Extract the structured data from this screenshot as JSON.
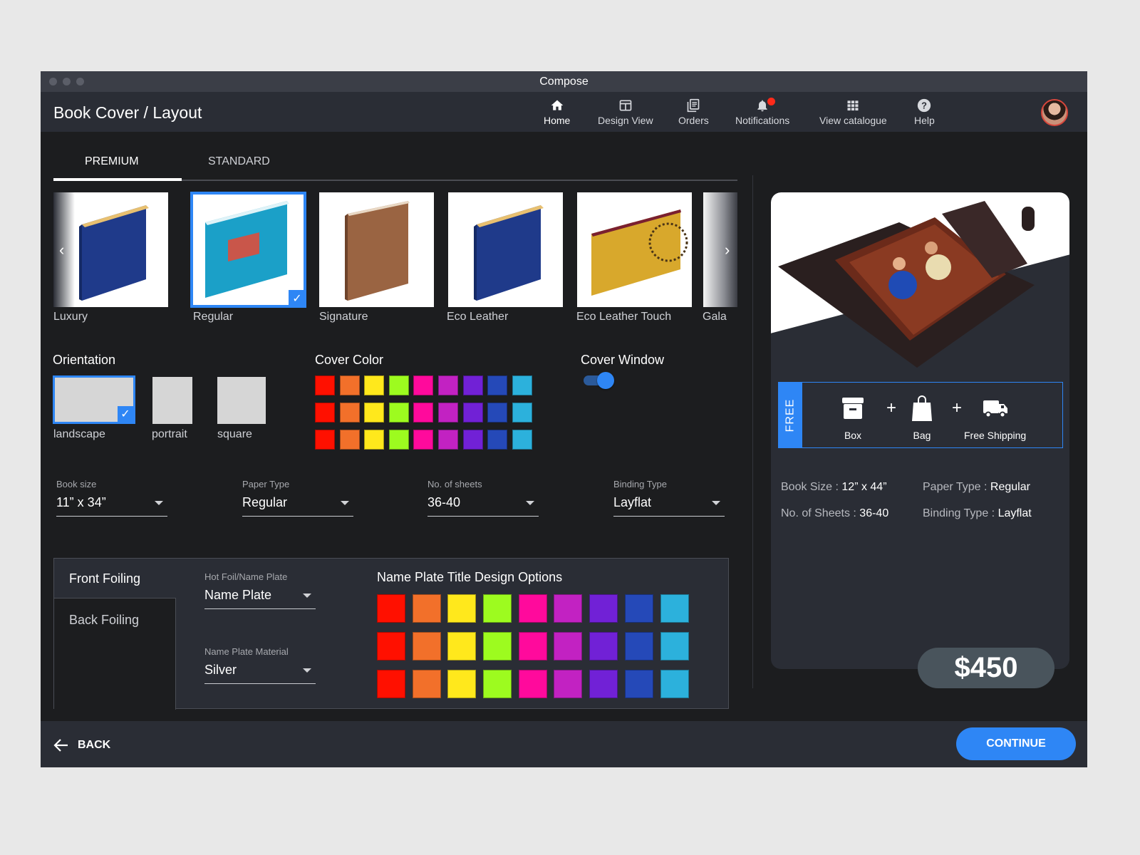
{
  "window": {
    "title": "Compose"
  },
  "header": {
    "page_title": "Book Cover / Layout",
    "nav": [
      {
        "label": "Home",
        "icon": "home-icon",
        "active": true
      },
      {
        "label": "Design View",
        "icon": "design-view-icon"
      },
      {
        "label": "Orders",
        "icon": "orders-icon"
      },
      {
        "label": "Notifications",
        "icon": "bell-icon",
        "badge": true
      },
      {
        "label": "View catalogue",
        "icon": "grid-icon"
      },
      {
        "label": "Help",
        "icon": "help-icon"
      }
    ]
  },
  "tabs": [
    {
      "label": "PREMIUM",
      "active": true
    },
    {
      "label": "STANDARD",
      "active": false
    }
  ],
  "covers": [
    {
      "label": "Luxury",
      "cover_color": "#1f3a8a",
      "selected": false
    },
    {
      "label": "Regular",
      "cover_color": "#1ba0c8",
      "selected": true
    },
    {
      "label": "Signature",
      "cover_color": "#9a6442",
      "selected": false
    },
    {
      "label": "Eco Leather",
      "cover_color": "#1f3a8a",
      "selected": false
    },
    {
      "label": "Eco Leather Touch",
      "cover_color": "#d8a82c",
      "selected": false
    },
    {
      "label": "Gala",
      "selected": false
    }
  ],
  "orientation": {
    "title": "Orientation",
    "options": [
      {
        "label": "landscape",
        "selected": true
      },
      {
        "label": "portrait",
        "selected": false
      },
      {
        "label": "square",
        "selected": false
      }
    ]
  },
  "cover_color": {
    "title": "Cover Color",
    "rows": 3,
    "colors": [
      "#ff1000",
      "#f2702a",
      "#ffe81c",
      "#9dfb1f",
      "#ff0a9c",
      "#c222c2",
      "#7121d6",
      "#2549b8",
      "#2cb1dc"
    ]
  },
  "cover_window": {
    "title": "Cover Window",
    "enabled": true
  },
  "fields": [
    {
      "label": "Book size",
      "value": "11” x 34”"
    },
    {
      "label": "Paper Type",
      "value": "Regular"
    },
    {
      "label": "No. of sheets",
      "value": "36-40"
    },
    {
      "label": "Binding Type",
      "value": "Layflat"
    }
  ],
  "foiling": {
    "tabs": [
      {
        "label": "Front Foiling",
        "active": true
      },
      {
        "label": "Back Foiling",
        "active": false
      }
    ],
    "hot_foil": {
      "label": "Hot Foil/Name Plate",
      "value": "Name Plate"
    },
    "material": {
      "label": "Name Plate Material",
      "value": "Silver"
    },
    "design_title": "Name Plate Title Design Options",
    "rows": 3,
    "colors": [
      "#ff1000",
      "#f2702a",
      "#ffe81c",
      "#9dfb1f",
      "#ff0a9c",
      "#c222c2",
      "#7121d6",
      "#2549b8",
      "#2cb1dc"
    ]
  },
  "preview": {
    "free_label": "FREE",
    "free_items": [
      {
        "label": "Box",
        "icon": "box-icon"
      },
      {
        "label": "Bag",
        "icon": "bag-icon"
      },
      {
        "label": "Free Shipping",
        "icon": "truck-icon"
      }
    ],
    "plus": "+",
    "summary": [
      {
        "key": "Book Size :",
        "value": "12” x 44”"
      },
      {
        "key": "Paper Type :",
        "value": "Regular"
      },
      {
        "key": "No. of Sheets :",
        "value": "36-40"
      },
      {
        "key": "Binding Type :",
        "value": "Layflat"
      }
    ],
    "price": "$450"
  },
  "footer": {
    "back_label": "BACK",
    "continue_label": "CONTINUE"
  }
}
